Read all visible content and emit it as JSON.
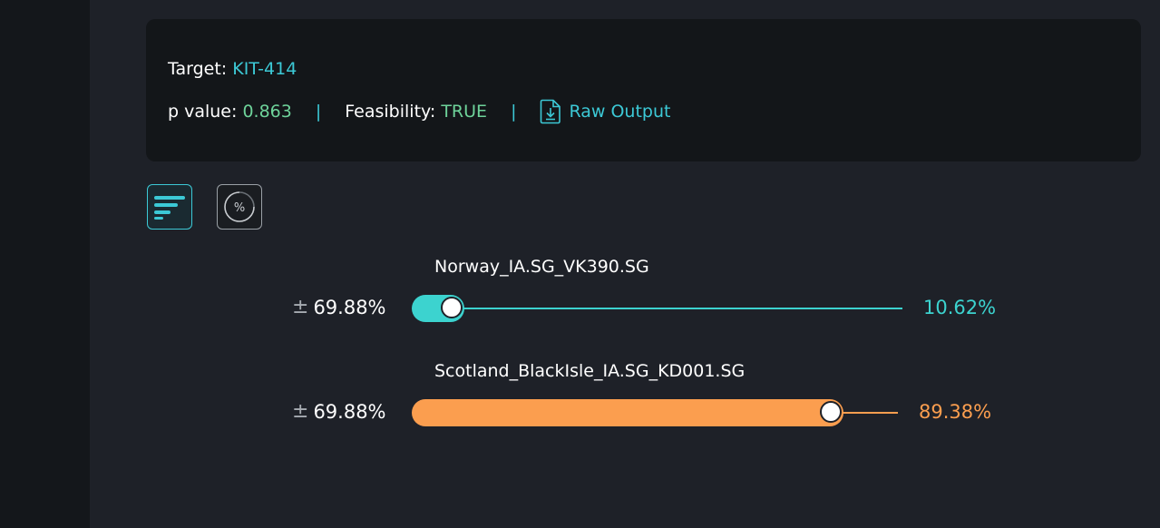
{
  "summary": {
    "target_label": "Target:",
    "target_value": "KIT-414",
    "p_label": "p value:",
    "p_value": "0.863",
    "separator": "|",
    "feasibility_label": "Feasibility:",
    "feasibility_value": "TRUE",
    "raw_output_label": "Raw Output"
  },
  "view_toggle": {
    "bars_icon": "bar-list-icon",
    "percent_icon": "percent-circle-icon",
    "percent_glyph": "%"
  },
  "rows": [
    {
      "name": "Norway_IA.SG_VK390.SG",
      "pm_symbol": "±",
      "pm_value": "69.88%",
      "percent": "10.62%",
      "fraction": 0.1062,
      "color": "#3cd3cf"
    },
    {
      "name": "Scotland_BlackIsle_IA.SG_KD001.SG",
      "pm_symbol": "±",
      "pm_value": "69.88%",
      "percent": "89.38%",
      "fraction": 0.8938,
      "color": "#fb9e4f"
    }
  ]
}
